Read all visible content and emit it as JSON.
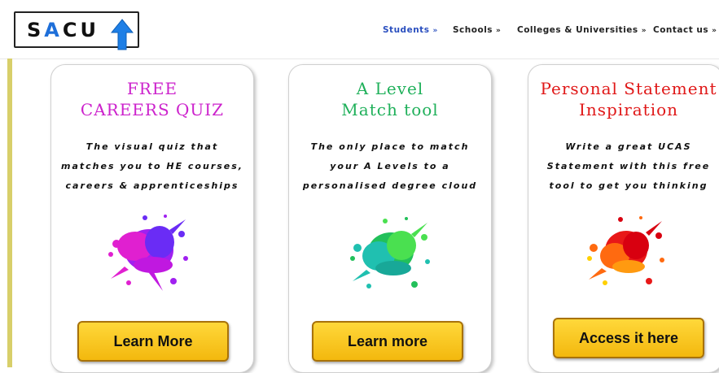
{
  "header": {
    "logo_text_1": "S",
    "logo_text_2": "A",
    "logo_text_3": "CU",
    "nav": [
      {
        "label": "Students",
        "chevron": "»"
      },
      {
        "label": "Schools",
        "chevron": "»"
      },
      {
        "label": "Colleges & Universities",
        "chevron": "»"
      },
      {
        "label": "Contact us",
        "chevron": "»"
      }
    ],
    "colors": {
      "active_nav": "#2a4fbf",
      "accent_bar": "#d8cf6a"
    }
  },
  "cards": [
    {
      "title_1": "FREE",
      "title_2": "CAREERS QUIZ",
      "title_color": "#cc22cc",
      "desc_1": "The visual quiz that",
      "desc_2": "matches you to HE courses,",
      "desc_3": "careers & apprenticeships",
      "image": "pink-purple-paint-splat",
      "button": "Learn More"
    },
    {
      "title_1": "A Level",
      "title_2": "Match tool",
      "title_color": "#1fb05a",
      "desc_1": "The only place to match",
      "desc_2": "your A Levels to a",
      "desc_3": "personalised degree cloud",
      "image": "green-teal-paint-splat",
      "button": "Learn more"
    },
    {
      "title_1": "Personal Statement",
      "title_2": "Inspiration",
      "title_color": "#e01818",
      "desc_1": "Write a great UCAS",
      "desc_2": "Statement with this free",
      "desc_3": "tool to get you thinking",
      "image": "red-orange-paint-splat",
      "button": "Access it here"
    }
  ]
}
